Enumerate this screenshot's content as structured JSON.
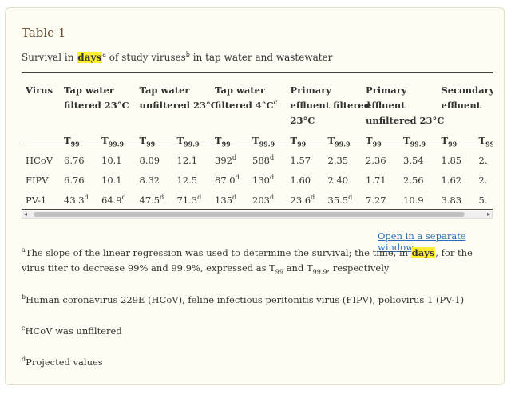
{
  "title": "Table 1",
  "caption": {
    "pre": "Survival in ",
    "highlight": "days",
    "sup_a": "a",
    "mid": " of study viruses",
    "sup_b": "b",
    "post": " in tap water and wastewater"
  },
  "columns": [
    {
      "lines": [
        "Tap water",
        "filtered 23°C"
      ],
      "sup": ""
    },
    {
      "lines": [
        "Tap water",
        "unfiltered 23°C"
      ],
      "sup": ""
    },
    {
      "lines": [
        "Tap water",
        "filtered 4°C"
      ],
      "sup": "c"
    },
    {
      "lines": [
        "Primary",
        "effluent filtered",
        "23°C"
      ],
      "sup": ""
    },
    {
      "lines": [
        "Primary",
        "effluent",
        "unfiltered 23°C"
      ],
      "sup": ""
    },
    {
      "lines": [
        "Secondary",
        "effluent"
      ],
      "sup": ""
    }
  ],
  "virus_header": "Virus",
  "subheaders": [
    {
      "base": "T",
      "sub": "99"
    },
    {
      "base": "T",
      "sub": "99.9"
    }
  ],
  "rows": [
    {
      "virus": "HCoV",
      "cells": [
        {
          "v": "6.76",
          "s": ""
        },
        {
          "v": "10.1",
          "s": ""
        },
        {
          "v": "8.09",
          "s": ""
        },
        {
          "v": "12.1",
          "s": ""
        },
        {
          "v": "392",
          "s": "d"
        },
        {
          "v": "588",
          "s": "d"
        },
        {
          "v": "1.57",
          "s": ""
        },
        {
          "v": "2.35",
          "s": ""
        },
        {
          "v": "2.36",
          "s": ""
        },
        {
          "v": "3.54",
          "s": ""
        },
        {
          "v": "1.85",
          "s": ""
        },
        {
          "v": "2.",
          "s": ""
        }
      ]
    },
    {
      "virus": "FIPV",
      "cells": [
        {
          "v": "6.76",
          "s": ""
        },
        {
          "v": "10.1",
          "s": ""
        },
        {
          "v": "8.32",
          "s": ""
        },
        {
          "v": "12.5",
          "s": ""
        },
        {
          "v": "87.0",
          "s": "d"
        },
        {
          "v": "130",
          "s": "d"
        },
        {
          "v": "1.60",
          "s": ""
        },
        {
          "v": "2.40",
          "s": ""
        },
        {
          "v": "1.71",
          "s": ""
        },
        {
          "v": "2.56",
          "s": ""
        },
        {
          "v": "1.62",
          "s": ""
        },
        {
          "v": "2.",
          "s": ""
        }
      ]
    },
    {
      "virus": "PV-1",
      "cells": [
        {
          "v": "43.3",
          "s": "d"
        },
        {
          "v": "64.9",
          "s": "d"
        },
        {
          "v": "47.5",
          "s": "d"
        },
        {
          "v": "71.3",
          "s": "d"
        },
        {
          "v": "135",
          "s": "d"
        },
        {
          "v": "203",
          "s": "d"
        },
        {
          "v": "23.6",
          "s": "d"
        },
        {
          "v": "35.5",
          "s": "d"
        },
        {
          "v": "7.27",
          "s": ""
        },
        {
          "v": "10.9",
          "s": ""
        },
        {
          "v": "3.83",
          "s": ""
        },
        {
          "v": "5.",
          "s": ""
        }
      ]
    }
  ],
  "link": "Open in a separate window",
  "footnotes": {
    "a": {
      "sup": "a",
      "pre": "The slope of the linear regression was used to determine the survival; the time, in ",
      "highlight": "days",
      "post1": ", for the virus titer to decrease 99% and 99.9%, expressed as T",
      "sub1": "99",
      "mid": " and T",
      "sub2": "99.9",
      "post2": ", respectively"
    },
    "b": {
      "sup": "b",
      "text": "Human coronavirus 229E (HCoV), feline infectious peritonitis virus (FIPV), poliovirus 1 (PV-1)"
    },
    "c": {
      "sup": "c",
      "text": "HCoV was unfiltered"
    },
    "d": {
      "sup": "d",
      "text": "Projected values"
    }
  }
}
